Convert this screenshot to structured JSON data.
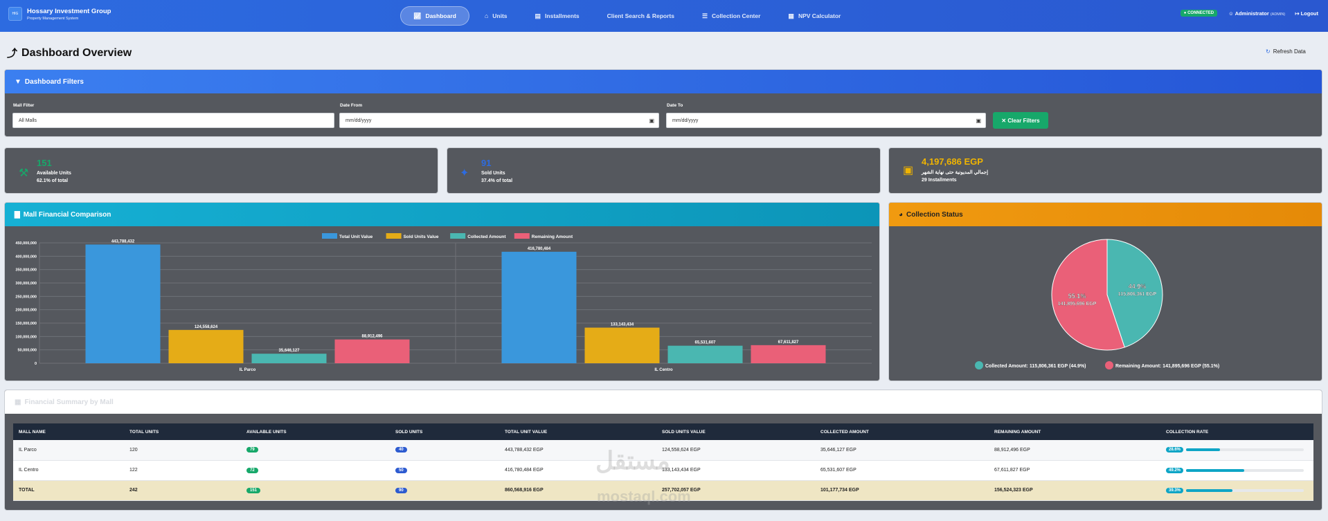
{
  "nav": {
    "brand_title": "Hossary Investment Group",
    "brand_sub": "Property Management System",
    "logo_text": "HIG",
    "tabs": [
      {
        "label": "Dashboard",
        "icon": "chart-line-icon"
      },
      {
        "label": "Units",
        "icon": "home-icon"
      },
      {
        "label": "Installments",
        "icon": "card-icon"
      },
      {
        "label": "Client Search & Reports",
        "icon": ""
      },
      {
        "label": "Collection Center",
        "icon": "list-icon"
      },
      {
        "label": "NPV Calculator",
        "icon": "calculator-icon"
      }
    ],
    "status": "CONNECTED",
    "user": "Administrator",
    "role": "(ADMIN)",
    "logout": "Logout"
  },
  "page": {
    "title": "Dashboard Overview",
    "refresh": "Refresh Data"
  },
  "filters": {
    "title": "Dashboard Filters",
    "mall_label": "Mall Filter",
    "mall_value": "All Malls",
    "from_label": "Date From",
    "from_placeholder": "mm/dd/yyyy",
    "to_label": "Date To",
    "to_placeholder": "mm/dd/yyyy",
    "clear": "Clear Filters"
  },
  "stats": [
    {
      "value": "151",
      "label": "Available Units",
      "sub": "62.1% of total",
      "color": "#17a86a"
    },
    {
      "value": "91",
      "label": "Sold Units",
      "sub": "37.4% of total",
      "color": "#2d6be0"
    },
    {
      "value": "4,197,686 EGP",
      "label": "إجمالي المديونية حتى نهاية الشهر",
      "sub": "29 Installments",
      "color": "#f0b400"
    }
  ],
  "comparison": {
    "title": "Mall Financial Comparison"
  },
  "collection": {
    "title": "Collection Status"
  },
  "chart_data": [
    {
      "type": "bar",
      "categories": [
        "IL Parco",
        "IL Centro"
      ],
      "series": [
        {
          "name": "Total Unit Value",
          "values": [
            443788432,
            416780484
          ],
          "labels": [
            "443,788,432",
            "416,780,484"
          ],
          "color": "#3a97dc"
        },
        {
          "name": "Sold Units Value",
          "values": [
            124558624,
            133143434
          ],
          "labels": [
            "124,558,624",
            "133,143,434"
          ],
          "color": "#e5ac17"
        },
        {
          "name": "Collected Amount",
          "values": [
            35646127,
            65531607
          ],
          "labels": [
            "35,646,127",
            "65,531,607"
          ],
          "color": "#4ab7b1"
        },
        {
          "name": "Remaining Amount",
          "values": [
            88912496,
            67611827
          ],
          "labels": [
            "88,912,496",
            "67,611,827"
          ],
          "color": "#ea6078"
        }
      ],
      "ylim": [
        0,
        450000000
      ],
      "yticks": [
        "0",
        "50,000,000",
        "100,000,000",
        "150,000,000",
        "200,000,000",
        "250,000,000",
        "300,000,000",
        "350,000,000",
        "400,000,000",
        "450,000,000"
      ],
      "legend": "top"
    },
    {
      "type": "pie",
      "slices": [
        {
          "name": "Collected Amount",
          "value": 44.9,
          "pct": "44.9%",
          "amount": "115,806,361 EGP",
          "legend": "Collected Amount: 115,806,361 EGP (44.9%)",
          "color": "#4ab7b1"
        },
        {
          "name": "Remaining Amount",
          "value": 55.1,
          "pct": "55.1%",
          "amount": "141,895,696 EGP",
          "legend": "Remaining Amount: 141,895,696 EGP (55.1%)",
          "color": "#ea6078"
        }
      ],
      "legend": "bottom"
    }
  ],
  "summary": {
    "title": "Financial Summary by Mall",
    "headers": [
      "MALL NAME",
      "TOTAL UNITS",
      "AVAILABLE UNITS",
      "SOLD UNITS",
      "TOTAL UNIT VALUE",
      "SOLD UNITS VALUE",
      "COLLECTED AMOUNT",
      "REMAINING AMOUNT",
      "COLLECTION RATE"
    ],
    "rows": [
      {
        "mall": "IL Parco",
        "total": "120",
        "available": "79",
        "sold": "40",
        "tuv": "443,788,432 EGP",
        "suv": "124,558,624 EGP",
        "collected": "35,646,127 EGP",
        "remaining": "88,912,496 EGP",
        "rate": "28.6%",
        "rate_value": 0.286
      },
      {
        "mall": "IL Centro",
        "total": "122",
        "available": "72",
        "sold": "50",
        "tuv": "416,780,484 EGP",
        "suv": "133,143,434 EGP",
        "collected": "65,531,607 EGP",
        "remaining": "67,611,827 EGP",
        "rate": "49.2%",
        "rate_value": 0.492
      },
      {
        "mall": "TOTAL",
        "total": "242",
        "available": "151",
        "sold": "90",
        "tuv": "860,568,916 EGP",
        "suv": "257,702,057 EGP",
        "collected": "101,177,734 EGP",
        "remaining": "156,524,323 EGP",
        "rate": "39.3%",
        "rate_value": 0.393
      }
    ]
  },
  "watermark": {
    "line1": "مستقل",
    "line2": "mostaql.com"
  }
}
